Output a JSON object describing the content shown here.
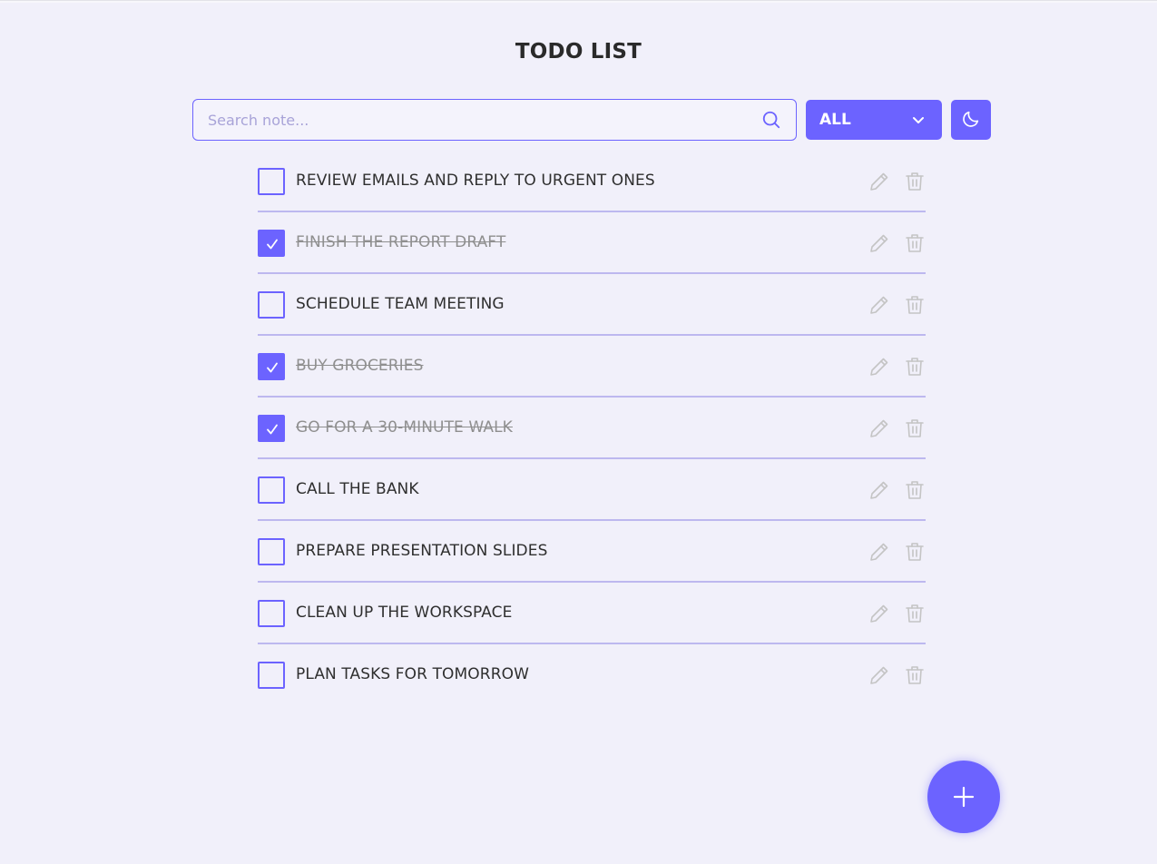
{
  "header": {
    "title": "TODO LIST"
  },
  "search": {
    "placeholder": "Search note...",
    "value": ""
  },
  "filter": {
    "selected": "ALL"
  },
  "colors": {
    "accent": "#6c63ff",
    "background": "#f1f0fa",
    "divider": "#bdb8ef",
    "done_text": "#8f8f8f",
    "icon_gray": "#c4c4c4"
  },
  "icons": {
    "search": "search-icon",
    "filter_toggle": "chevron-down-icon",
    "theme": "moon-icon",
    "edit": "pencil-icon",
    "delete": "trash-icon",
    "add": "plus-icon",
    "check": "check-icon"
  },
  "todos": [
    {
      "text": "REVIEW EMAILS AND REPLY TO URGENT ONES",
      "done": false
    },
    {
      "text": "FINISH THE REPORT DRAFT",
      "done": true
    },
    {
      "text": "SCHEDULE TEAM MEETING",
      "done": false
    },
    {
      "text": "BUY GROCERIES",
      "done": true
    },
    {
      "text": "GO FOR A 30-MINUTE WALK",
      "done": true
    },
    {
      "text": "CALL THE BANK",
      "done": false
    },
    {
      "text": "PREPARE PRESENTATION SLIDES",
      "done": false
    },
    {
      "text": "CLEAN UP THE WORKSPACE",
      "done": false
    },
    {
      "text": "PLAN TASKS FOR TOMORROW",
      "done": false
    }
  ]
}
